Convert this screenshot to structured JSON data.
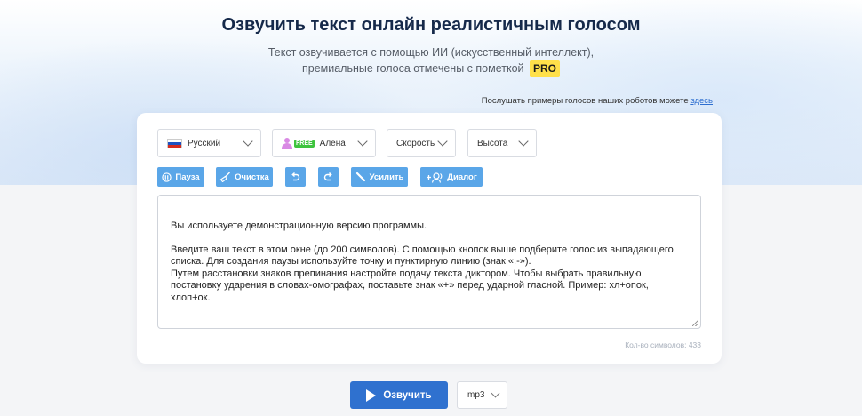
{
  "header": {
    "title": "Озвучить текст онлайн реалистичным голосом",
    "subtitle_line1": "Текст озвучивается с помощью ИИ (искусственный интеллект),",
    "subtitle_line2": "премиальные голоса отмечены с пометкой",
    "pro_badge": "PRO",
    "samples_text": "Послушать примеры голосов наших роботов можете",
    "samples_link": "здесь"
  },
  "controls": {
    "language": {
      "icon": "flag-ru-icon",
      "value": "Русский"
    },
    "voice": {
      "icon": "female-avatar-icon",
      "badge": "FREE",
      "value": "Алена"
    },
    "speed": {
      "value": "Скорость"
    },
    "pitch": {
      "value": "Высота"
    }
  },
  "toolbar": {
    "pause_label": "Пауза",
    "clear_label": "Очистка",
    "undo_icon": "undo-icon",
    "redo_icon": "redo-icon",
    "emphasis_label": "Усилить",
    "dialog_label": "Диалог"
  },
  "editor": {
    "text": "Вы используете демонстрационную версию программы.\n\nВведите ваш текст в этом окне (до 200 символов). С помощью кнопок выше подберите голос из выпадающего\nсписка. Для создания паузы используйте точку и пунктирную линию (знак «.-»).\nПутем расстановки знаков препинания настройте подачу текста диктором. Чтобы выбрать правильную\nпостановку ударения в словах-омографах, поставьте знак «+» перед ударной гласной. Пример: хл+опок,\nхлоп+ок.",
    "char_count": "Кол-во символов: 433"
  },
  "actions": {
    "speak_label": "Озвучить",
    "format_value": "mp3"
  },
  "colors": {
    "accent": "#2f71cf",
    "tool_button": "#5aa6e8",
    "pro_badge": "#ffe04a",
    "free_badge": "#3ec43e",
    "title": "#15294a"
  }
}
